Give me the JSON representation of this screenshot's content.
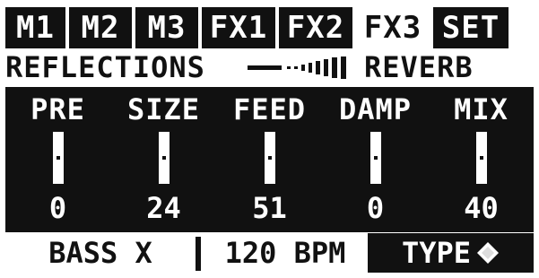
{
  "tabs": [
    {
      "label": "M1",
      "active": false
    },
    {
      "label": "M2",
      "active": false
    },
    {
      "label": "M3",
      "active": false
    },
    {
      "label": "FX1",
      "active": false
    },
    {
      "label": "FX2",
      "active": false
    },
    {
      "label": "FX3",
      "active": true
    },
    {
      "label": "SET",
      "active": false
    }
  ],
  "effect": {
    "name": "REFLECTIONS",
    "type": "REVERB"
  },
  "params": [
    {
      "label": "PRE",
      "value": "0"
    },
    {
      "label": "SIZE",
      "value": "24"
    },
    {
      "label": "FEED",
      "value": "51"
    },
    {
      "label": "DAMP",
      "value": "0"
    },
    {
      "label": "MIX",
      "value": "40"
    }
  ],
  "footer": {
    "bass": "BASS X",
    "tempo": "120 BPM",
    "type_label": "TYPE"
  },
  "colors": {
    "background": "#ffffff",
    "foreground": "#111111"
  },
  "icons": {
    "type_icon": "diamond-arrows-icon",
    "effect_art": "reverb-decay-icon"
  }
}
